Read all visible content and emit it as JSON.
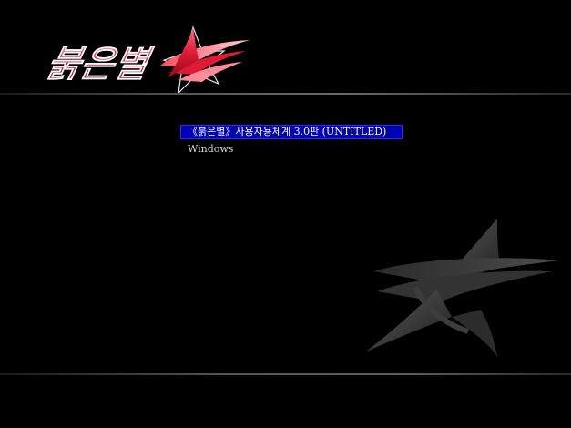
{
  "logo": {
    "text": "붉은별",
    "primary_color": "#e01a34",
    "icon": "red-star-emblem-icon"
  },
  "boot_menu": {
    "items": [
      {
        "label": "《붉은별》사용자용체계 3.0판 (UNTITLED)",
        "selected": true
      },
      {
        "label": "Windows",
        "selected": false
      }
    ],
    "highlight_color": "#0000b4"
  },
  "watermark": {
    "icon": "star-emblem-watermark-icon"
  }
}
